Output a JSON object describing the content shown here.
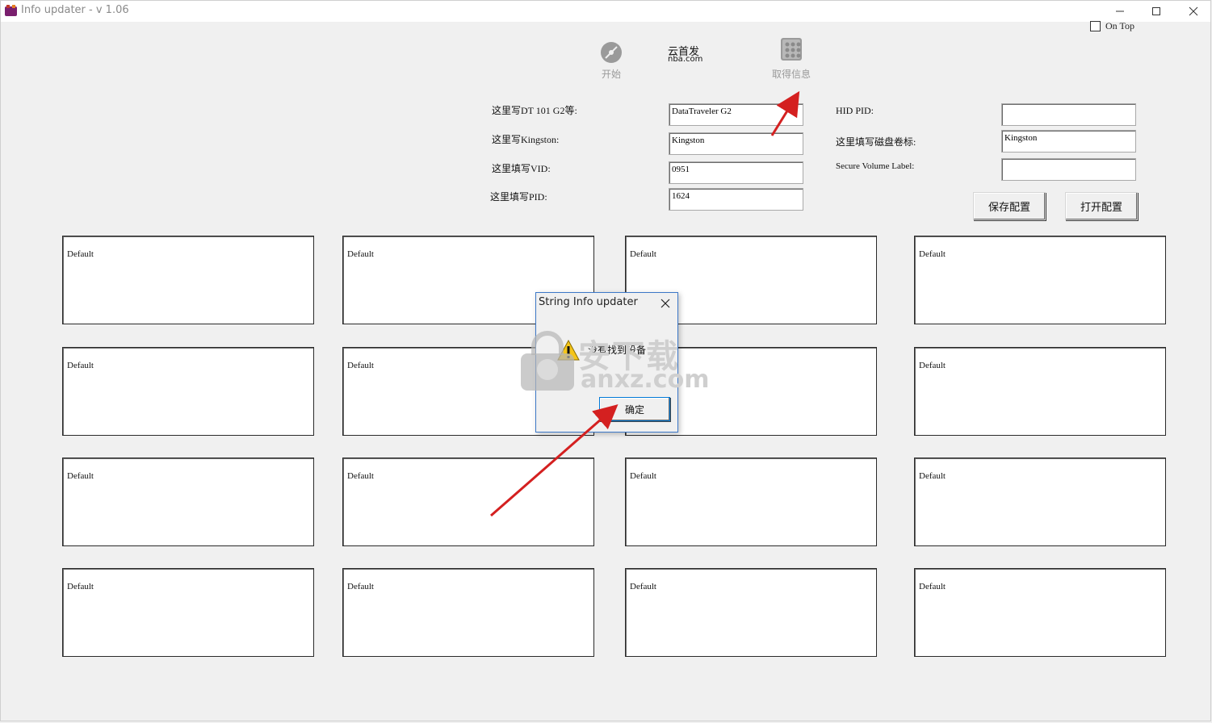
{
  "window": {
    "title": "Info updater - v 1.06",
    "on_top_label": "On Top"
  },
  "toolbar": {
    "start_label": "开始",
    "get_info_label": "取得信息",
    "overlay_line1": "云首发",
    "overlay_line2": "nba.com"
  },
  "form": {
    "product_label": "这里写DT 101 G2等:",
    "product_value": "DataTraveler G2",
    "vendor_label": "这里写Kingston:",
    "vendor_value": "Kingston",
    "vid_label": "这里填写VID:",
    "vid_value": "0951",
    "pid_label": "这里填写PID:",
    "pid_value": "1624",
    "hid_pid_label": "HID PID:",
    "hid_pid_value": "",
    "volume_label_label": "这里填写磁盘卷标:",
    "volume_label_value": "Kingston",
    "secure_label": "Secure Volume Label:",
    "secure_value": "",
    "save_config": "保存配置",
    "open_config": "打开配置"
  },
  "grid": {
    "cells": [
      "Default",
      "Default",
      "Default",
      "Default",
      "Default",
      "Default",
      "Default",
      "Default",
      "Default",
      "Default",
      "Default",
      "Default",
      "Default",
      "Default",
      "Default",
      "Default"
    ]
  },
  "dialog": {
    "title": "String Info updater",
    "message": "没有找到设备",
    "ok_label": "确定"
  },
  "watermark": {
    "main": "安下载",
    "domain": "anxz.com"
  },
  "colors": {
    "window_bg": "#f0f0f0",
    "dialog_border": "#3c78c8",
    "arrow": "#d42020"
  }
}
